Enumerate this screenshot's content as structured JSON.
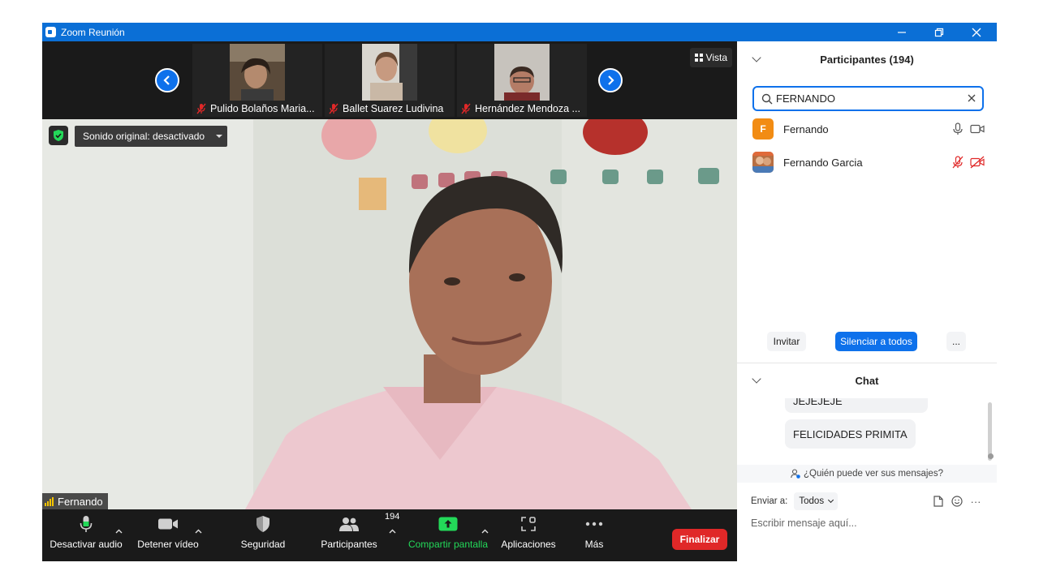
{
  "window": {
    "title": "Zoom Reunión"
  },
  "thumbnails": [
    {
      "name": "Pulido Bolaños Maria..."
    },
    {
      "name": "Ballet Suarez Ludivina"
    },
    {
      "name": "Hernández Mendoza ..."
    }
  ],
  "view_button": {
    "label": "Vista"
  },
  "main_video": {
    "sound_option": "Sonido original: desactivado",
    "speaker_name": "Fernando"
  },
  "toolbar": {
    "audio_label": "Desactivar audio",
    "video_label": "Detener vídeo",
    "security_label": "Seguridad",
    "participants_label": "Participantes",
    "participants_count": "194",
    "share_label": "Compartir pantalla",
    "apps_label": "Aplicaciones",
    "more_label": "Más",
    "end_label": "Finalizar"
  },
  "participants_panel": {
    "header": "Participantes (194)",
    "search_value": "FERNANDO",
    "rows": [
      {
        "initial": "F",
        "name": "Fernando",
        "avatar_color": "#f28c13"
      },
      {
        "initial": "",
        "name": "Fernando Garcia",
        "avatar_color": "#b86f43"
      }
    ],
    "invite_label": "Invitar",
    "mute_all_label": "Silenciar a todos",
    "more_label": "..."
  },
  "chat_panel": {
    "header": "Chat",
    "messages": [
      {
        "text": "JEJEJEJE"
      },
      {
        "text": "FELICIDADES PRIMITA"
      }
    ],
    "visibility_note": "¿Quién puede ver sus mensajes?",
    "send_to_label": "Enviar a:",
    "send_to_value": "Todos",
    "more_label": "···",
    "input_placeholder": "Escribir mensaje aquí..."
  },
  "colors": {
    "accent": "#0e71eb",
    "title_bar": "#0b6fd6",
    "end_button": "#e02828",
    "share_green": "#23d959",
    "muted_red": "#e02828"
  }
}
